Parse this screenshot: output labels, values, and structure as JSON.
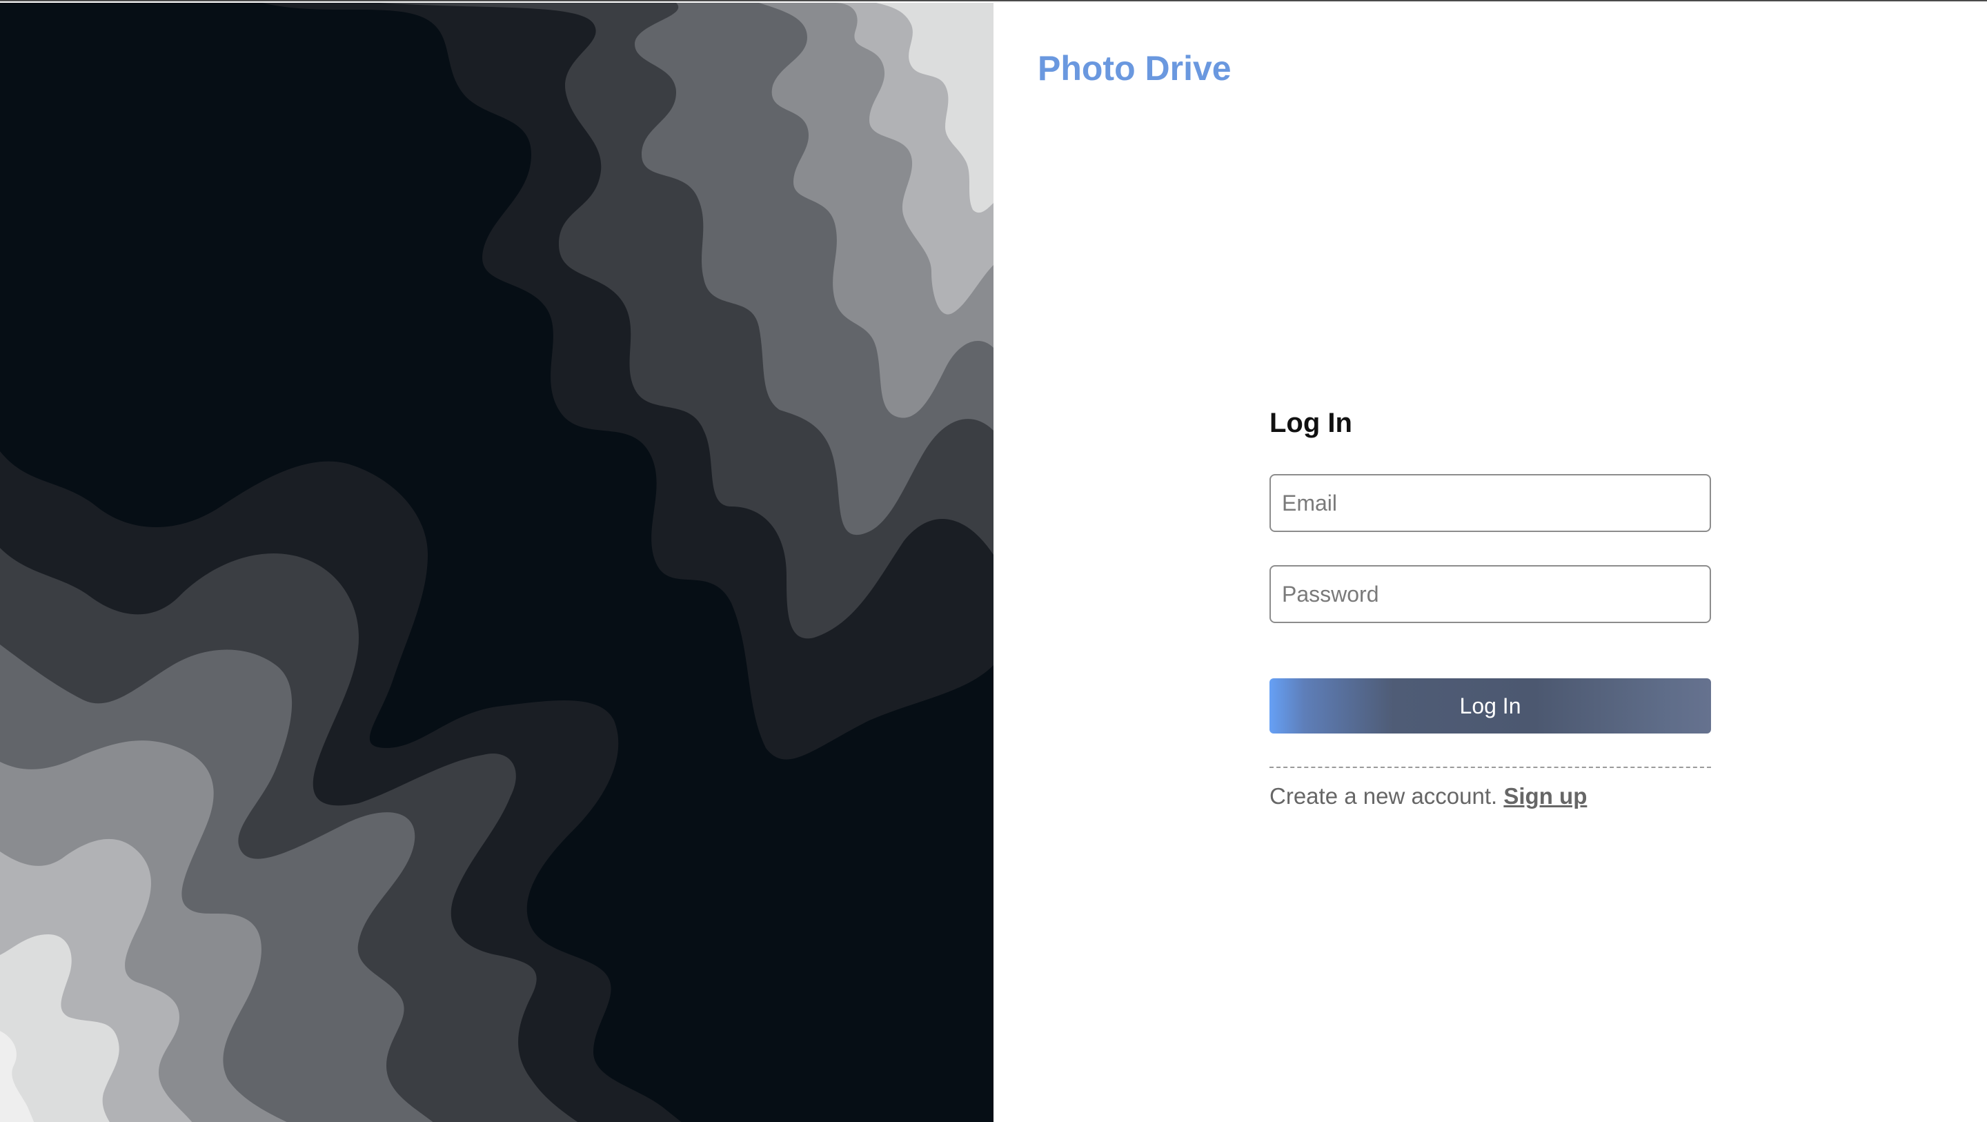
{
  "brand": {
    "name": "Photo Drive",
    "color": "#6a98df"
  },
  "art": {
    "description_name": "wavy-grayscale-pattern",
    "colors": [
      "#060e15",
      "#1a1e24",
      "#3b3e43",
      "#62656a",
      "#8a8c90",
      "#b1b2b5",
      "#dcdddd"
    ]
  },
  "login": {
    "title": "Log In",
    "email_placeholder": "Email",
    "password_placeholder": "Password",
    "submit_label": "Log In",
    "signup_prompt": "Create a new account.",
    "signup_link": "Sign up"
  }
}
